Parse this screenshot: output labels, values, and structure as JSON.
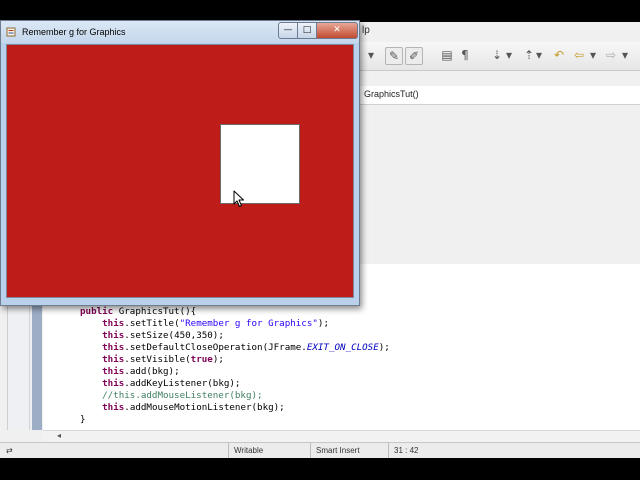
{
  "ide": {
    "menu_help": "lp",
    "breadcrumb": "GraphicsTut()",
    "toolbar_icons": [
      "dropdown-arrow-icon",
      "toggle-mark-occurrences-icon",
      "highlight-icon",
      "block-selection-icon",
      "show-whitespace-icon",
      "next-annotation-icon",
      "previous-annotation-icon",
      "back-icon",
      "forward-icon"
    ],
    "editor": {
      "lines": [
        {
          "indent": "",
          "parts": [
            {
              "t": "public",
              "c": "kw"
            },
            {
              "t": " GraphicsTut(){",
              "c": ""
            }
          ]
        },
        {
          "indent": "    ",
          "parts": [
            {
              "t": "this",
              "c": "kw"
            },
            {
              "t": ".setTitle(",
              "c": ""
            },
            {
              "t": "\"Remember g for Graphics\"",
              "c": "str"
            },
            {
              "t": ");",
              "c": ""
            }
          ]
        },
        {
          "indent": "    ",
          "parts": [
            {
              "t": "this",
              "c": "kw"
            },
            {
              "t": ".setSize(450,350);",
              "c": ""
            }
          ]
        },
        {
          "indent": "    ",
          "parts": [
            {
              "t": "this",
              "c": "kw"
            },
            {
              "t": ".setDefaultCloseOperation(JFrame.",
              "c": ""
            },
            {
              "t": "EXIT_ON_CLOSE",
              "c": "cst"
            },
            {
              "t": ");",
              "c": ""
            }
          ]
        },
        {
          "indent": "    ",
          "parts": [
            {
              "t": "this",
              "c": "kw"
            },
            {
              "t": ".setVisible(",
              "c": ""
            },
            {
              "t": "true",
              "c": "kw"
            },
            {
              "t": ");",
              "c": ""
            }
          ]
        },
        {
          "indent": "    ",
          "parts": [
            {
              "t": "this",
              "c": "kw"
            },
            {
              "t": ".add(bkg);",
              "c": ""
            }
          ]
        },
        {
          "indent": "    ",
          "parts": [
            {
              "t": "this",
              "c": "kw"
            },
            {
              "t": ".addKeyListener(bkg);",
              "c": ""
            }
          ]
        },
        {
          "indent": "    ",
          "parts": [
            {
              "t": "//this.addMouseListener(bkg);",
              "c": "cmt"
            }
          ]
        },
        {
          "indent": "    ",
          "parts": [
            {
              "t": "this",
              "c": "kw"
            },
            {
              "t": ".addMouseMotionListener(bkg);",
              "c": ""
            }
          ]
        },
        {
          "indent": "",
          "parts": [
            {
              "t": "}",
              "c": ""
            }
          ]
        }
      ]
    },
    "status": {
      "writable": "Writable",
      "insert_mode": "Smart Insert",
      "position": "31 : 42"
    }
  },
  "window": {
    "title": "Remember g for Graphics",
    "controls": {
      "minimize": "—",
      "maximize": "□",
      "close": "✕"
    },
    "background_color": "#be1c18",
    "square_color": "#ffffff"
  }
}
